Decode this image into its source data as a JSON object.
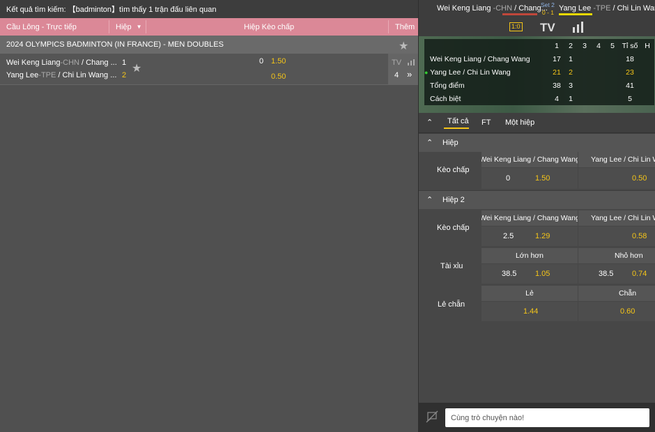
{
  "search": {
    "result_text": "Kết quả tìm kiếm: 【badminton】tìm thấy 1 trận đấu liên quan"
  },
  "list_header": {
    "sport_label": "Cầu Lông - Trực tiếp",
    "period_label": "Hiệp",
    "market_label": "Hiệp Kèo chấp",
    "more_label": "Thêm"
  },
  "league": {
    "name": "2024 OLYMPICS BADMINTON (IN FRANCE) - MEN DOUBLES"
  },
  "match": {
    "team1_name": "Wei Keng Liang",
    "team1_country": "-CHN",
    "team1_partner": " / Chang ...",
    "team2_name": "Yang Lee",
    "team2_country": "-TPE",
    "team2_partner": " / Chi Lin Wang ...",
    "team1_score": "1",
    "team2_score": "2",
    "handicap_line": "0",
    "handicap_odds1": "1.50",
    "handicap_odds2": "0.50",
    "tv_label": "TV",
    "more_count": "4",
    "more_arrow": "»"
  },
  "scorebar": {
    "home": "Wei Keng Liang",
    "home_country": " -CHN",
    "home_partner": " / Chang...",
    "set_label": "Set 2",
    "set_score": "0 - 1",
    "away": "Yang Lee",
    "away_country": " -TPE",
    "away_partner": " / Chi Lin Wang..."
  },
  "media": {
    "score_icon_text": "1:0",
    "tv_label": "TV"
  },
  "scoreboard": {
    "headers": [
      "1",
      "2",
      "3",
      "4",
      "5",
      "Tỉ số",
      "H"
    ],
    "rows": [
      {
        "name": "Wei Keng Liang / Chang Wang",
        "s1": "17",
        "s2": "1",
        "s3": "",
        "s4": "",
        "s5": "",
        "total": "18",
        "server": false
      },
      {
        "name": "Yang Lee / Chi Lin Wang",
        "s1": "21",
        "s2": "2",
        "s3": "",
        "s4": "",
        "s5": "",
        "total": "23",
        "server": true
      },
      {
        "name": "Tổng điểm",
        "s1": "38",
        "s2": "3",
        "s3": "",
        "s4": "",
        "s5": "",
        "total": "41",
        "server": false
      },
      {
        "name": "Cách biệt",
        "s1": "4",
        "s2": "1",
        "s3": "",
        "s4": "",
        "s5": "",
        "total": "5",
        "server": false
      }
    ]
  },
  "tabs": {
    "all": "Tất cả",
    "ft": "FT",
    "one_half": "Một hiệp"
  },
  "section1": {
    "title": "Hiệp",
    "team1": "Wei Keng Liang / Chang Wang",
    "team2": "Yang Lee / Chi Lin Wang",
    "handicap_label": "Kèo chấp",
    "line": "0",
    "odds1": "1.50",
    "odds2": "0.50"
  },
  "section2": {
    "title": "Hiệp 2",
    "team1": "Wei Keng Liang / Chang Wang",
    "team2": "Yang Lee / Chi Lin Wang",
    "handicap_label": "Kèo chấp",
    "hc_line": "2.5",
    "hc_odds1": "1.29",
    "hc_odds2": "0.58",
    "ou_label": "Tài xỉu",
    "over_label": "Lớn hơn",
    "under_label": "Nhỏ hơn",
    "over_line": "38.5",
    "over_odds": "1.05",
    "under_line": "38.5",
    "under_odds": "0.74",
    "oe_label": "Lẻ chẵn",
    "odd_label": "Lẻ",
    "even_label": "Chẵn",
    "odd_odds": "1.44",
    "even_odds": "0.60"
  },
  "chat": {
    "placeholder": "Cùng trò chuyện nào!"
  }
}
